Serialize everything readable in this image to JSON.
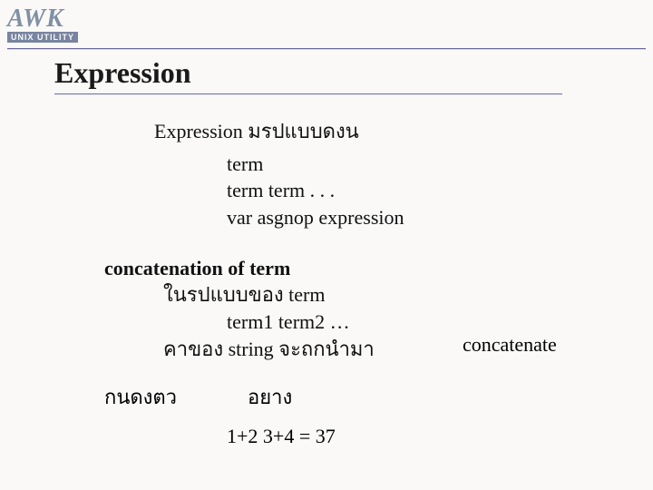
{
  "logo": {
    "main": "AWK",
    "sub": "UNIX UTILITY"
  },
  "title": "Expression",
  "intro": "Expression มรปแบบดงน",
  "syntax": {
    "line1": "term",
    "line2": "term term . . .",
    "line3": "var asgnop expression"
  },
  "concat": {
    "heading": "concatenation of term",
    "line1": "ในรปแบบของ   term",
    "line2": "term1  term2  …",
    "line3": "คาของ   string จะถกนำมา",
    "right": "concatenate"
  },
  "footer": {
    "left": "กนดงตว",
    "right": "อยาง"
  },
  "example": "1+2 3+4 = 37"
}
